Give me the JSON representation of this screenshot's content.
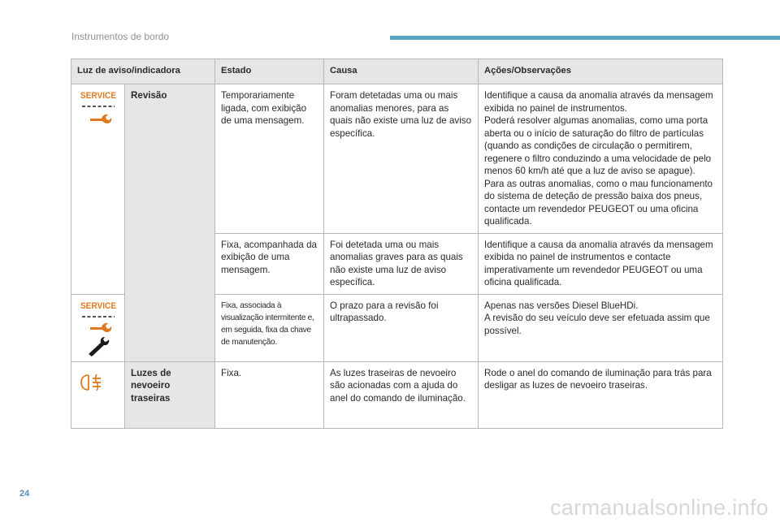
{
  "header": {
    "section_title": "Instrumentos de bordo"
  },
  "page": {
    "number": "24",
    "watermark": "carmanualsonline.info"
  },
  "table": {
    "headers": [
      "Luz de aviso/indicadora",
      "Estado",
      "Causa",
      "Ações/Observações"
    ],
    "rows": [
      {
        "label": "Revisão",
        "icons": [
          "service-text-icon",
          "wrench-icon"
        ],
        "entries": [
          {
            "estado": "Temporariamente ligada, com exibição de uma mensagem.",
            "causa": "Foram detetadas uma ou mais anomalias menores, para as quais não existe uma luz de aviso específica.",
            "acoes": [
              "Identifique a causa da anomalia através da mensagem exibida no painel de instrumentos.",
              "Poderá resolver algumas anomalias, como uma porta aberta ou o início de saturação do filtro de partículas (quando as condições de circulação o permitirem, regenere o filtro conduzindo a uma velocidade de pelo menos 60 km/h até que a luz de aviso se apague).",
              "Para as outras anomalias, como o mau funcionamento do sistema de deteção de pressão baixa dos pneus, contacte um revendedor PEUGEOT ou uma oficina qualificada."
            ]
          },
          {
            "estado": "Fixa, acompanhada da exibição de uma mensagem.",
            "causa": "Foi detetada uma ou mais anomalias graves para as quais não existe uma luz de aviso específica.",
            "acoes": [
              "Identifique a causa da anomalia através da mensagem exibida no painel de instrumentos e contacte imperativamente um revendedor PEUGEOT ou uma oficina qualificada."
            ]
          },
          {
            "estado": "Fixa, associada à visualização intermitente e, em seguida, fixa da chave de manutenção.",
            "causa": "O prazo para a revisão foi ultrapassado.",
            "acoes": [
              "Apenas nas versões Diesel BlueHDi.",
              "A revisão do seu veículo deve ser efetuada assim que possível."
            ]
          }
        ]
      },
      {
        "label": "Luzes de nevoeiro traseiras",
        "icons": [
          "rear-fog-light-icon"
        ],
        "entries": [
          {
            "estado": "Fixa.",
            "causa": "As luzes traseiras de nevoeiro são acionadas com a ajuda do anel do comando de iluminação.",
            "acoes": [
              "Rode o anel do comando de iluminação para trás para desligar as luzes de nevoeiro traseiras."
            ]
          }
        ]
      }
    ]
  },
  "icons": {
    "service_text": "SERVICE",
    "service_color": "#e07a20",
    "fog_color": "#e07a20",
    "wrench_dark_color": "#1a1a1a"
  }
}
